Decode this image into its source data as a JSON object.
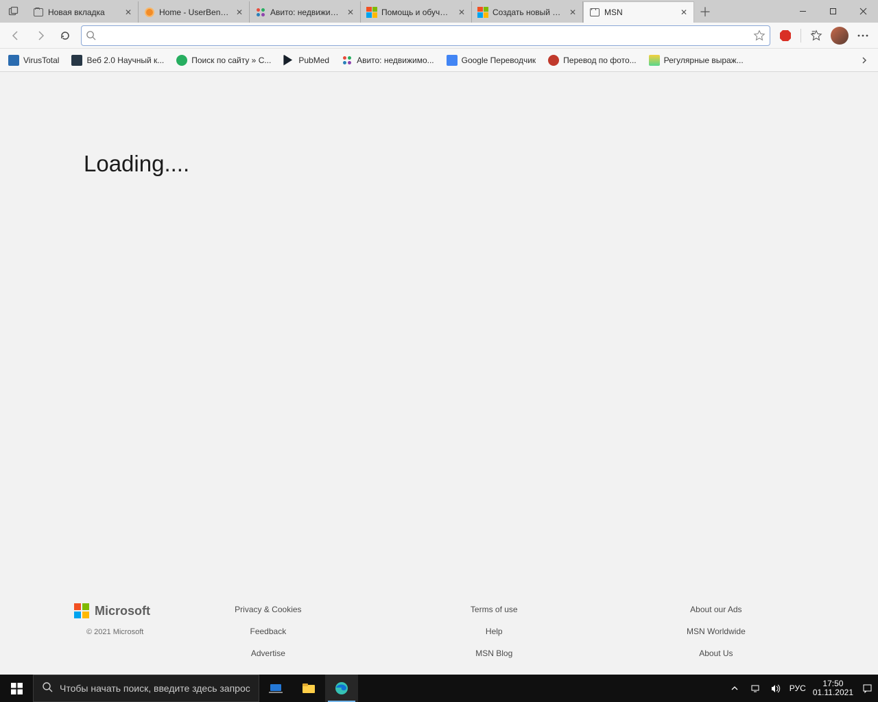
{
  "tabs": [
    {
      "title": "Новая вкладка"
    },
    {
      "title": "Home - UserBenchmark"
    },
    {
      "title": "Авито: недвижимость"
    },
    {
      "title": "Помощь и обучение"
    },
    {
      "title": "Создать новый вопрос"
    },
    {
      "title": "MSN"
    }
  ],
  "bookmarks": [
    {
      "label": "VirusTotal"
    },
    {
      "label": "Веб 2.0 Научный к..."
    },
    {
      "label": "Поиск по сайту » С..."
    },
    {
      "label": "PubMed"
    },
    {
      "label": "Авито: недвижимо..."
    },
    {
      "label": "Google Переводчик"
    },
    {
      "label": "Перевод по фото..."
    },
    {
      "label": "Регулярные выраж..."
    }
  ],
  "page": {
    "loading": "Loading....",
    "brand": "Microsoft",
    "copyright": "© 2021 Microsoft"
  },
  "footer": {
    "col1": [
      "Privacy & Cookies",
      "Feedback",
      "Advertise"
    ],
    "col2": [
      "Terms of use",
      "Help",
      "MSN Blog"
    ],
    "col3": [
      "About our Ads",
      "MSN Worldwide",
      "About Us"
    ]
  },
  "taskbar": {
    "search_placeholder": "Чтобы начать поиск, введите здесь запрос",
    "lang": "РУС",
    "time": "17:50",
    "date": "01.11.2021"
  }
}
